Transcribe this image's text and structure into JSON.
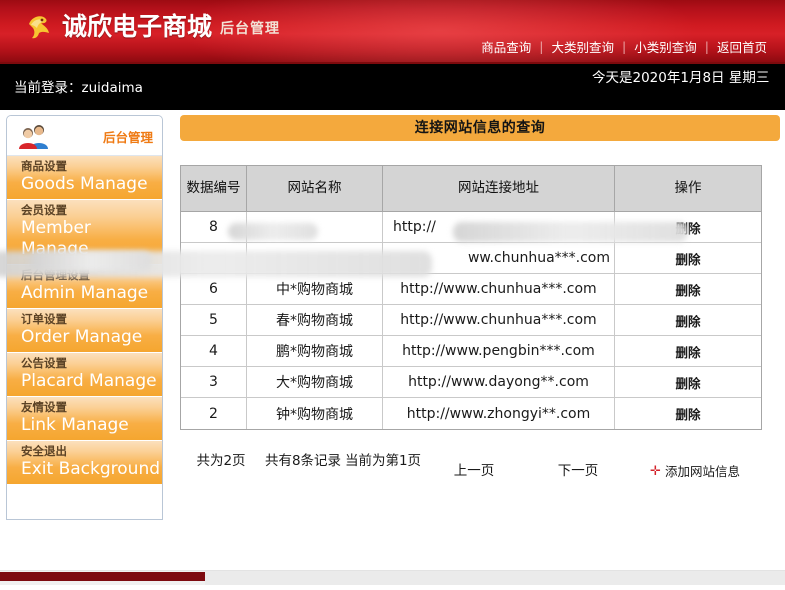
{
  "header": {
    "logo_text": "诚欣电子商城",
    "logo_sub": "后台管理",
    "logo_icon": "bird-logo-icon",
    "nav": [
      {
        "label": "商品查询"
      },
      {
        "label": "大类别查询"
      },
      {
        "label": "小类别查询"
      },
      {
        "label": "返回首页"
      }
    ],
    "nav_separator": "|"
  },
  "loginbar": {
    "current_login": "当前登录：zuidaima",
    "date_text": "今天是2020年1月8日 星期三"
  },
  "sidebar": {
    "head_label": "后台管理",
    "head_icon": "users-icon",
    "items": [
      {
        "cn": "商品设置",
        "en": "Goods Manage"
      },
      {
        "cn": "会员设置",
        "en": "Member Manage"
      },
      {
        "cn": "后台管理设置",
        "en": "Admin Manage"
      },
      {
        "cn": "订单设置",
        "en": "Order Manage"
      },
      {
        "cn": "公告设置",
        "en": "Placard Manage"
      },
      {
        "cn": "友情设置",
        "en": "Link Manage"
      },
      {
        "cn": "安全退出",
        "en": "Exit Background"
      }
    ]
  },
  "content": {
    "panel_title": "连接网站信息的查询",
    "table": {
      "columns": [
        "数据编号",
        "网站名称",
        "网站连接地址",
        "操作"
      ],
      "action_label": "删除",
      "rows": [
        {
          "id": "8",
          "name": "",
          "url": "http://",
          "action": "删除",
          "redacted": true
        },
        {
          "id": "",
          "name": "",
          "url": "ww.chunhua***.com",
          "action": "删除",
          "redacted": true
        },
        {
          "id": "6",
          "name": "中*购物商城",
          "url": "http://www.chunhua***.com",
          "action": "删除",
          "redacted": false
        },
        {
          "id": "5",
          "name": "春*购物商城",
          "url": "http://www.chunhua***.com",
          "action": "删除",
          "redacted": false
        },
        {
          "id": "4",
          "name": "鹏*购物商城",
          "url": "http://www.pengbin***.com",
          "action": "删除",
          "redacted": false
        },
        {
          "id": "3",
          "name": "大*购物商城",
          "url": "http://www.dayong**.com",
          "action": "删除",
          "redacted": false
        },
        {
          "id": "2",
          "name": "钟*购物商城",
          "url": "http://www.zhongyi**.com",
          "action": "删除",
          "redacted": false
        }
      ]
    },
    "pager": {
      "total_pages": "共为2页",
      "total_records": "共有8条记录",
      "current_page": "当前为第1页",
      "prev": "上一页",
      "next": "下一页",
      "add_label": "添加网站信息",
      "add_icon": "plus-icon"
    }
  },
  "colors": {
    "banner_red": "#d72027",
    "accent_orange": "#f4a93d",
    "menu_orange": "#f5a62f",
    "scrollbar_thumb": "#7d0a10",
    "link_red": "#d3222a"
  }
}
